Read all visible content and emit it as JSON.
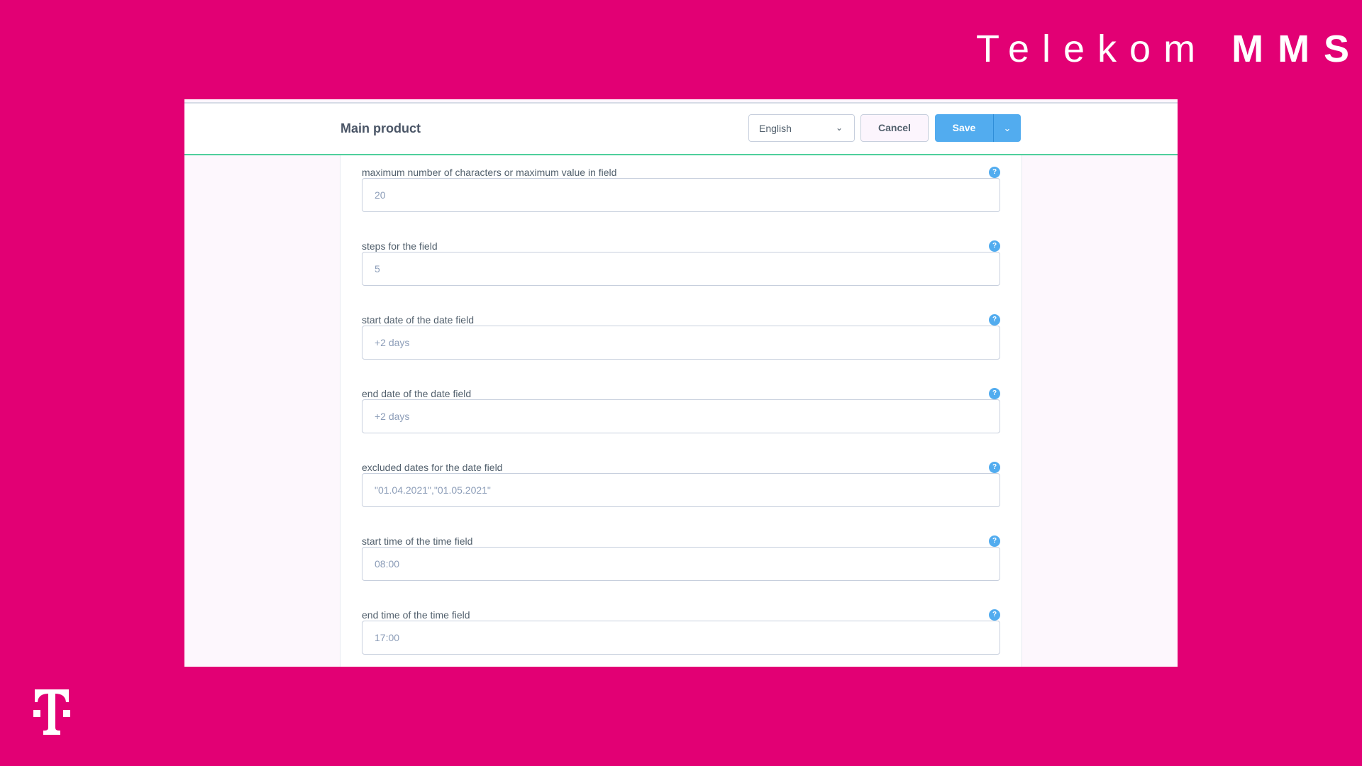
{
  "brand": {
    "light": "Telekom",
    "bold": "MMS",
    "logo_letter": "T"
  },
  "colors": {
    "brand": "#e20074",
    "accent": "#52acef",
    "header_border": "#4fcf9c"
  },
  "header": {
    "title": "Main product",
    "language": "English",
    "cancel": "Cancel",
    "save": "Save"
  },
  "fields": [
    {
      "label": "maximum number of characters or maximum value in field",
      "value": "20"
    },
    {
      "label": "steps for the field",
      "value": "5"
    },
    {
      "label": "start date of the date field",
      "value": "+2 days"
    },
    {
      "label": "end date of the date field",
      "value": "+2 days"
    },
    {
      "label": "excluded dates for the date field",
      "value": "\"01.04.2021\",\"01.05.2021\""
    },
    {
      "label": "start time of the time field",
      "value": "08:00"
    },
    {
      "label": "end time of the time field",
      "value": "17:00"
    }
  ],
  "help_glyph": "?"
}
